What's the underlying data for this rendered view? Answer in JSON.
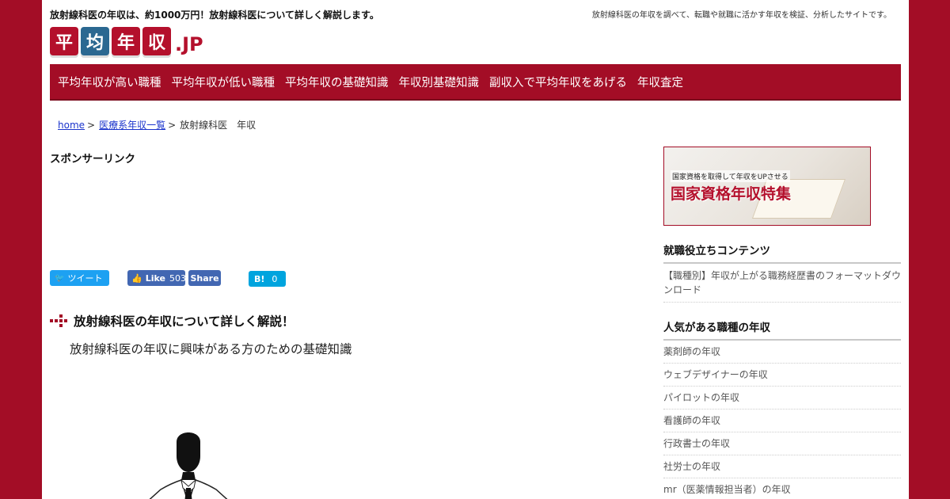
{
  "header": {
    "tagline": "放射線科医の年収は、約1000万円！放射線科医について詳しく解説します。",
    "site_desc": "放射線科医の年収を調べて、転職や就職に活かす年収を検証、分析したサイトです。",
    "logo": {
      "chars": [
        "平",
        "均",
        "年",
        "収"
      ],
      "suffix": ".JP"
    }
  },
  "nav": {
    "items": [
      "平均年収が高い職種",
      "平均年収が低い職種",
      "平均年収の基礎知識",
      "年収別基礎知識",
      "副収入で平均年収をあげる",
      "年収査定"
    ]
  },
  "breadcrumb": {
    "home": "home",
    "category": "医療系年収一覧",
    "current": "放射線科医　年収",
    "separator": ">"
  },
  "main": {
    "sponsor_label": "スポンサーリンク",
    "social": {
      "tweet": "ツイート",
      "like": "Like",
      "like_count": "503",
      "share": "Share",
      "hatena": "B!",
      "hatena_count": "0"
    },
    "heading": "放射線科医の年収について詳しく解説！",
    "lead": "放射線科医の年収に興味がある方のための基礎知識"
  },
  "sidebar": {
    "banner": {
      "small": "国家資格を取得して年収をUPさせる",
      "big": "国家資格年収特集"
    },
    "section1": {
      "title": "就職役立ちコンテンツ",
      "items": [
        "【職種別】年収が上がる職務経歴書のフォーマットダウンロード"
      ]
    },
    "section2": {
      "title": "人気がある職種の年収",
      "items": [
        "薬剤師の年収",
        "ウェブデザイナーの年収",
        "パイロットの年収",
        "看護師の年収",
        "行政書士の年収",
        "社労士の年収",
        "mr（医薬情報担当者）の年収"
      ]
    }
  },
  "colors": {
    "brand": "#a30d26",
    "blue": "#2b6891",
    "link": "#1a33cc"
  }
}
